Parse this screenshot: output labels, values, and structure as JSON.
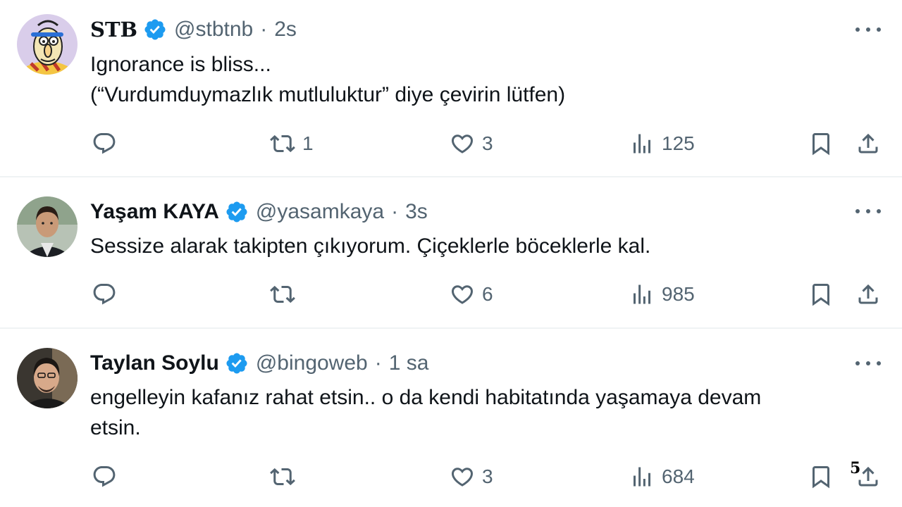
{
  "tweets": [
    {
      "name": "STB",
      "handle": "@stbtnb",
      "separator": "·",
      "time": "2s",
      "text_lines": [
        "Ignorance is bliss...",
        "(“Vurdumduymazlık mutluluktur” diye çevirin lütfen)"
      ],
      "reply_count": "",
      "retweet_count": "1",
      "like_count": "3",
      "view_count": "125",
      "avatar": "cartoon-avatar"
    },
    {
      "name": "Yaşam KAYA",
      "handle": "@yasamkaya",
      "separator": "·",
      "time": "3s",
      "text_lines": [
        "Sessize alarak takipten çıkıyorum. Çiçeklerle böceklerle kal."
      ],
      "reply_count": "",
      "retweet_count": "",
      "like_count": "6",
      "view_count": "985",
      "avatar": "photo-avatar"
    },
    {
      "name": "Taylan Soylu",
      "handle": "@bingoweb",
      "separator": "·",
      "time": "1 sa",
      "text_lines": [
        "engelleyin kafanız rahat etsin.. o da kendi habitatında yaşamaya devam",
        "etsin."
      ],
      "reply_count": "",
      "retweet_count": "",
      "like_count": "3",
      "view_count": "684",
      "avatar": "photo-avatar"
    }
  ],
  "page_number": "5",
  "colors": {
    "text": "#0f1419",
    "secondary": "#536471",
    "verified": "#1d9bf0",
    "divider": "#eff3f4"
  },
  "icons": [
    "reply-icon",
    "retweet-icon",
    "like-icon",
    "views-icon",
    "bookmark-icon",
    "share-icon",
    "more-icon",
    "verified-icon"
  ]
}
